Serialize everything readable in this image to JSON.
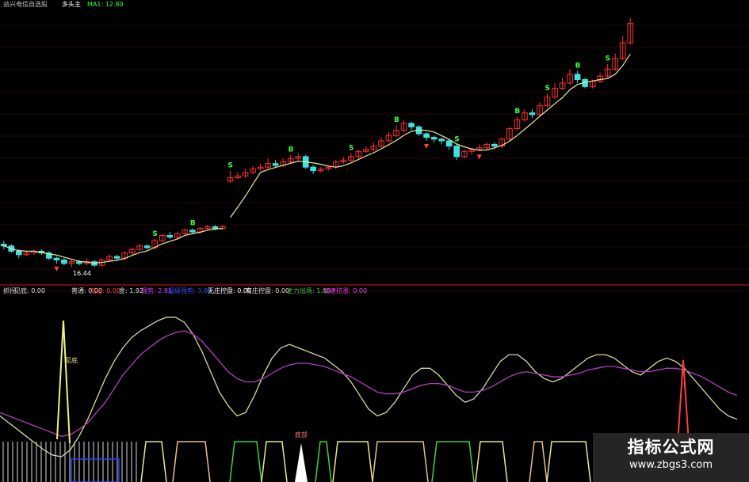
{
  "header": {
    "main_title": "益兴电信自选股",
    "main_sub": "多头主",
    "main_value": "MA1: 12.80"
  },
  "sub_legend": [
    {
      "text": "抓拐",
      "color": "#e0e0e0"
    },
    {
      "text": "见底: 0.00",
      "color": "#e0e0e0"
    },
    {
      "text": "普通: 0.00",
      "color": "#e0e0e0"
    },
    {
      "text": "流出: 0.00",
      "color": "#ff4040"
    },
    {
      "text": "金: 1.92",
      "color": "#e0e0e0"
    },
    {
      "text": "强势: 2.81",
      "color": "#d040ff"
    },
    {
      "text": "超级强势: 3.00",
      "color": "#3050ff"
    },
    {
      "text": "无庄控盘: 0.00",
      "color": "#ffffff"
    },
    {
      "text": "有庄控盘: 0.00",
      "color": "#e0e0e0"
    },
    {
      "text": "主力出场: 1.00",
      "color": "#40d040"
    },
    {
      "text": "加速拉涨: 0.00",
      "color": "#ff40ff"
    }
  ],
  "price_annotation": "16.44",
  "signals": {
    "buy_label": "见底",
    "buy_label2": "底部",
    "sell_marker": "S",
    "up_marker": "B"
  },
  "watermark": {
    "title": "指标公式网",
    "url": "www.zbgs3.com"
  },
  "colors": {
    "background": "#000000",
    "up": "#ff3030",
    "down": "#40e0e0",
    "ma": "#e8e8a0",
    "k_line": "#d8d8a0",
    "d_line": "#b040c0",
    "divider": "#8a1010",
    "signal_green": "#40ff40"
  },
  "chart_data": [
    {
      "type": "candlestick",
      "title": "",
      "candles": [
        [
          12.6,
          12.5,
          12.8,
          12.3
        ],
        [
          12.5,
          12.2,
          12.6,
          12.1
        ],
        [
          12.2,
          12.0,
          12.3,
          11.8
        ],
        [
          12.0,
          12.1,
          12.2,
          11.9
        ],
        [
          12.1,
          12.2,
          12.3,
          12.0
        ],
        [
          12.2,
          12.1,
          12.3,
          12.0
        ],
        [
          12.1,
          11.8,
          12.2,
          11.7
        ],
        [
          11.8,
          11.7,
          11.9,
          11.5
        ],
        [
          11.7,
          11.5,
          11.8,
          11.4
        ],
        [
          11.5,
          11.6,
          11.7,
          11.3
        ],
        [
          11.6,
          11.5,
          11.7,
          11.4
        ],
        [
          11.5,
          11.6,
          11.8,
          11.4
        ],
        [
          11.6,
          11.4,
          11.7,
          11.3
        ],
        [
          11.4,
          11.7,
          11.8,
          11.3
        ],
        [
          11.7,
          11.9,
          12.0,
          11.6
        ],
        [
          11.9,
          11.8,
          12.0,
          11.7
        ],
        [
          11.8,
          12.1,
          12.2,
          11.7
        ],
        [
          12.1,
          12.3,
          12.4,
          12.0
        ],
        [
          12.3,
          12.5,
          12.6,
          12.2
        ],
        [
          12.5,
          12.4,
          12.6,
          12.3
        ],
        [
          12.4,
          12.8,
          12.9,
          12.3
        ],
        [
          12.8,
          13.1,
          13.2,
          12.7
        ],
        [
          13.1,
          13.0,
          13.3,
          12.9
        ],
        [
          13.0,
          13.2,
          13.3,
          12.9
        ],
        [
          13.2,
          13.4,
          13.5,
          13.1
        ],
        [
          13.4,
          13.3,
          13.5,
          13.2
        ],
        [
          13.3,
          13.5,
          13.6,
          13.2
        ],
        [
          13.5,
          13.6,
          13.7,
          13.4
        ],
        [
          13.6,
          13.5,
          13.7,
          13.4
        ],
        [
          13.5,
          13.6,
          13.7,
          13.4
        ],
        [
          16.2,
          16.4,
          16.8,
          16.1
        ],
        [
          16.4,
          16.5,
          16.7,
          16.3
        ],
        [
          16.5,
          16.7,
          16.9,
          16.4
        ],
        [
          16.7,
          16.9,
          17.1,
          16.6
        ],
        [
          16.9,
          17.0,
          17.2,
          16.8
        ],
        [
          17.0,
          17.2,
          17.5,
          16.9
        ],
        [
          17.2,
          17.1,
          17.4,
          17.0
        ],
        [
          17.1,
          17.3,
          17.5,
          17.0
        ],
        [
          17.3,
          17.5,
          17.7,
          17.2
        ],
        [
          17.5,
          17.6,
          17.8,
          17.4
        ],
        [
          17.6,
          17.0,
          17.7,
          16.9
        ],
        [
          17.0,
          16.8,
          17.1,
          16.6
        ],
        [
          16.8,
          16.9,
          17.0,
          16.7
        ],
        [
          16.9,
          17.0,
          17.1,
          16.8
        ],
        [
          17.0,
          17.3,
          17.4,
          16.9
        ],
        [
          17.3,
          17.4,
          17.6,
          17.2
        ],
        [
          17.4,
          17.6,
          17.8,
          17.3
        ],
        [
          17.6,
          17.9,
          18.0,
          17.5
        ],
        [
          17.9,
          18.0,
          18.2,
          17.8
        ],
        [
          18.0,
          18.2,
          18.4,
          17.9
        ],
        [
          18.2,
          18.5,
          18.7,
          18.1
        ],
        [
          18.5,
          18.8,
          19.0,
          18.4
        ],
        [
          18.8,
          19.1,
          19.4,
          18.7
        ],
        [
          19.1,
          19.5,
          19.7,
          19.0
        ],
        [
          19.5,
          19.3,
          19.6,
          19.1
        ],
        [
          19.3,
          18.9,
          19.4,
          18.8
        ],
        [
          18.9,
          18.7,
          19.0,
          18.5
        ],
        [
          18.7,
          18.6,
          18.8,
          18.4
        ],
        [
          18.6,
          18.5,
          18.7,
          18.3
        ],
        [
          18.5,
          18.2,
          18.6,
          18.0
        ],
        [
          18.2,
          17.6,
          18.3,
          17.4
        ],
        [
          17.6,
          17.9,
          18.0,
          17.5
        ],
        [
          17.9,
          18.0,
          18.1,
          17.7
        ],
        [
          18.0,
          18.1,
          18.3,
          17.9
        ],
        [
          18.1,
          18.3,
          18.4,
          18.0
        ],
        [
          18.3,
          18.2,
          18.4,
          18.0
        ],
        [
          18.2,
          18.6,
          18.7,
          18.1
        ],
        [
          18.6,
          19.2,
          19.3,
          18.5
        ],
        [
          19.2,
          19.7,
          19.9,
          19.1
        ],
        [
          19.7,
          20.1,
          20.3,
          19.6
        ],
        [
          20.1,
          20.0,
          20.3,
          19.8
        ],
        [
          20.0,
          20.5,
          20.7,
          19.9
        ],
        [
          20.5,
          21.0,
          21.2,
          20.4
        ],
        [
          21.0,
          21.5,
          21.8,
          20.9
        ],
        [
          21.5,
          21.8,
          22.1,
          21.4
        ],
        [
          21.8,
          22.3,
          22.6,
          21.7
        ],
        [
          22.3,
          22.0,
          22.5,
          21.8
        ],
        [
          22.0,
          21.6,
          22.1,
          21.5
        ],
        [
          21.6,
          21.9,
          22.0,
          21.5
        ],
        [
          21.9,
          22.2,
          22.4,
          21.8
        ],
        [
          22.2,
          22.6,
          22.9,
          22.1
        ],
        [
          22.6,
          23.2,
          23.5,
          22.5
        ],
        [
          23.2,
          24.1,
          24.5,
          23.1
        ],
        [
          24.1,
          25.2,
          25.5,
          24.0
        ]
      ],
      "ylim": [
        10.5,
        26.0
      ],
      "grid": true
    },
    {
      "type": "line",
      "title": "",
      "series": [
        {
          "values": [
            30,
            26,
            22,
            18,
            14,
            10,
            7,
            6,
            10,
            18,
            28,
            40,
            52,
            62,
            70,
            76,
            80,
            83,
            86,
            88,
            88,
            85,
            78,
            68,
            56,
            44,
            36,
            30,
            32,
            42,
            54,
            64,
            70,
            72,
            70,
            68,
            66,
            64,
            60,
            56,
            50,
            42,
            34,
            30,
            32,
            38,
            46,
            54,
            58,
            58,
            54,
            48,
            42,
            38,
            40,
            46,
            54,
            62,
            66,
            66,
            62,
            56,
            52,
            50,
            52,
            56,
            60,
            64,
            66,
            66,
            64,
            60,
            56,
            54,
            58,
            62,
            64,
            62,
            58,
            52,
            46,
            40,
            34,
            30,
            28
          ]
        },
        {
          "values": [
            32,
            30,
            28,
            26,
            24,
            22,
            20,
            18,
            19,
            22,
            26,
            32,
            38,
            46,
            54,
            60,
            66,
            70,
            74,
            77,
            79,
            80,
            78,
            74,
            68,
            62,
            56,
            52,
            50,
            50,
            52,
            55,
            58,
            60,
            61,
            61,
            60,
            59,
            57,
            55,
            53,
            50,
            47,
            44,
            43,
            43,
            44,
            46,
            48,
            49,
            49,
            48,
            46,
            44,
            44,
            45,
            47,
            50,
            53,
            55,
            56,
            55,
            54,
            53,
            53,
            54,
            55,
            57,
            58,
            59,
            59,
            58,
            57,
            56,
            56,
            57,
            58,
            58,
            57,
            55,
            53,
            50,
            47,
            44,
            42
          ]
        }
      ],
      "ylim": [
        0,
        100
      ],
      "grid": false
    }
  ]
}
